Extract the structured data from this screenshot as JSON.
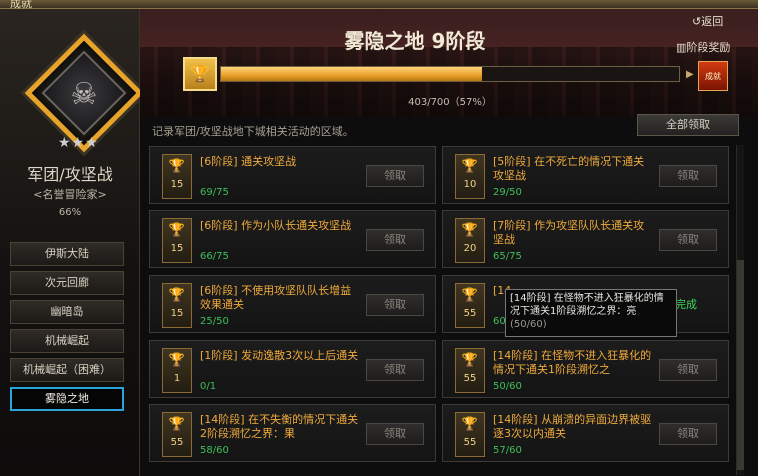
{
  "window": {
    "title": "成就"
  },
  "left": {
    "category_title": "军团/攻坚战",
    "category_subtitle": "<名誉冒险家>",
    "category_percent": "66%",
    "emblem_icon": "horned-skull-icon",
    "stars": "★★★",
    "nav": [
      {
        "label": "伊斯大陆",
        "active": false
      },
      {
        "label": "次元回廊",
        "active": false
      },
      {
        "label": "幽暗岛",
        "active": false
      },
      {
        "label": "机械崛起",
        "active": false
      },
      {
        "label": "机械崛起（困难）",
        "active": false
      },
      {
        "label": "雾隐之地",
        "active": true
      }
    ]
  },
  "header": {
    "stage_title": "雾隐之地  9阶段",
    "back_label": "返回",
    "reward_label": "阶段奖励",
    "progress_text": "403/700（57%）",
    "progress_fraction": 0.57,
    "reward_icon_text": "成就",
    "description": "记录军团/攻坚战地下城相关活动的区域。",
    "claim_all_label": "全部领取"
  },
  "cards": [
    {
      "level": "15",
      "title": "[6阶段] 通关攻坚战",
      "count": "69/75",
      "action": "领取",
      "completed": false
    },
    {
      "level": "10",
      "title": "[5阶段] 在不死亡的情况下通关攻坚战",
      "count": "29/50",
      "action": "领取",
      "completed": false
    },
    {
      "level": "15",
      "title": "[6阶段] 作为小队长通关攻坚战",
      "count": "66/75",
      "action": "领取",
      "completed": false
    },
    {
      "level": "20",
      "title": "[7阶段] 作为攻坚队队长通关攻坚战",
      "count": "65/75",
      "action": "领取",
      "completed": false
    },
    {
      "level": "15",
      "title": "[6阶段] 不使用攻坚队队长增益效果通关",
      "count": "25/50",
      "action": "领取",
      "completed": false
    },
    {
      "level": "55",
      "title": "[14",
      "count": "60",
      "action": "完成",
      "completed": true
    },
    {
      "level": "1",
      "title": "[1阶段] 发动逸散3次以上后通关",
      "count": "0/1",
      "action": "领取",
      "completed": false
    },
    {
      "level": "55",
      "title": "[14阶段] 在怪物不进入狂暴化的情况下通关1阶段溯忆之",
      "count": "50/60",
      "action": "领取",
      "completed": false
    },
    {
      "level": "55",
      "title": "[14阶段] 在不失衡的情况下通关2阶段溯忆之界：果",
      "count": "58/60",
      "action": "领取",
      "completed": false
    },
    {
      "level": "55",
      "title": "[14阶段] 从崩溃的异面边界被驱逐3次以内通关",
      "count": "57/60",
      "action": "领取",
      "completed": false
    }
  ],
  "tooltip": {
    "text": "[14阶段] 在怪物不进入狂暴化的情况下通关1阶段溯忆之界：亮",
    "count": "(50/60)"
  },
  "colors": {
    "accent_gold": "#f0aa3a",
    "progress_fill": "#e8a12a",
    "count_green": "#3fbf5a",
    "active_nav_border": "#29a3d8"
  }
}
